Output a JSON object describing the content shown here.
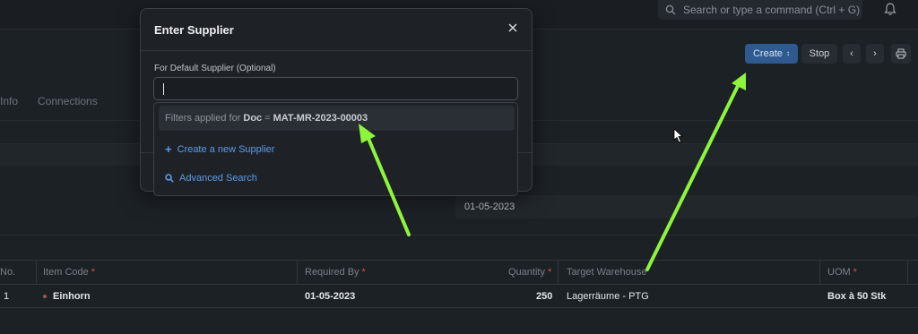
{
  "topbar": {
    "search_placeholder": "Search or type a command (Ctrl + G)"
  },
  "toolbar": {
    "create_label": "Create",
    "stop_label": "Stop"
  },
  "tabs": [
    "Info",
    "Connections"
  ],
  "form": {
    "date_value": "01-05-2023"
  },
  "table": {
    "headers": [
      "No.",
      "Item Code",
      "Required By",
      "Quantity",
      "Target Warehouse",
      "UOM"
    ],
    "required": [
      false,
      true,
      true,
      true,
      false,
      true
    ],
    "row": {
      "no": "1",
      "item_code": "Einhorn",
      "required_by": "01-05-2023",
      "quantity": "250",
      "warehouse": "Lagerräume - PTG",
      "uom": "Box à 50 Stk"
    }
  },
  "dialog": {
    "title": "Enter Supplier",
    "field_label": "For Default Supplier (Optional)",
    "input_value": "",
    "filter_prefix": "Filters applied for",
    "filter_field": "Doc",
    "filter_eq": "=",
    "filter_value": "MAT-MR-2023-00003",
    "create_new": "Create a new Supplier",
    "advanced_search": "Advanced Search"
  },
  "colors": {
    "accent": "#2e5a8f",
    "link": "#5c9ce6",
    "annotation_arrow": "#8cf53c"
  }
}
